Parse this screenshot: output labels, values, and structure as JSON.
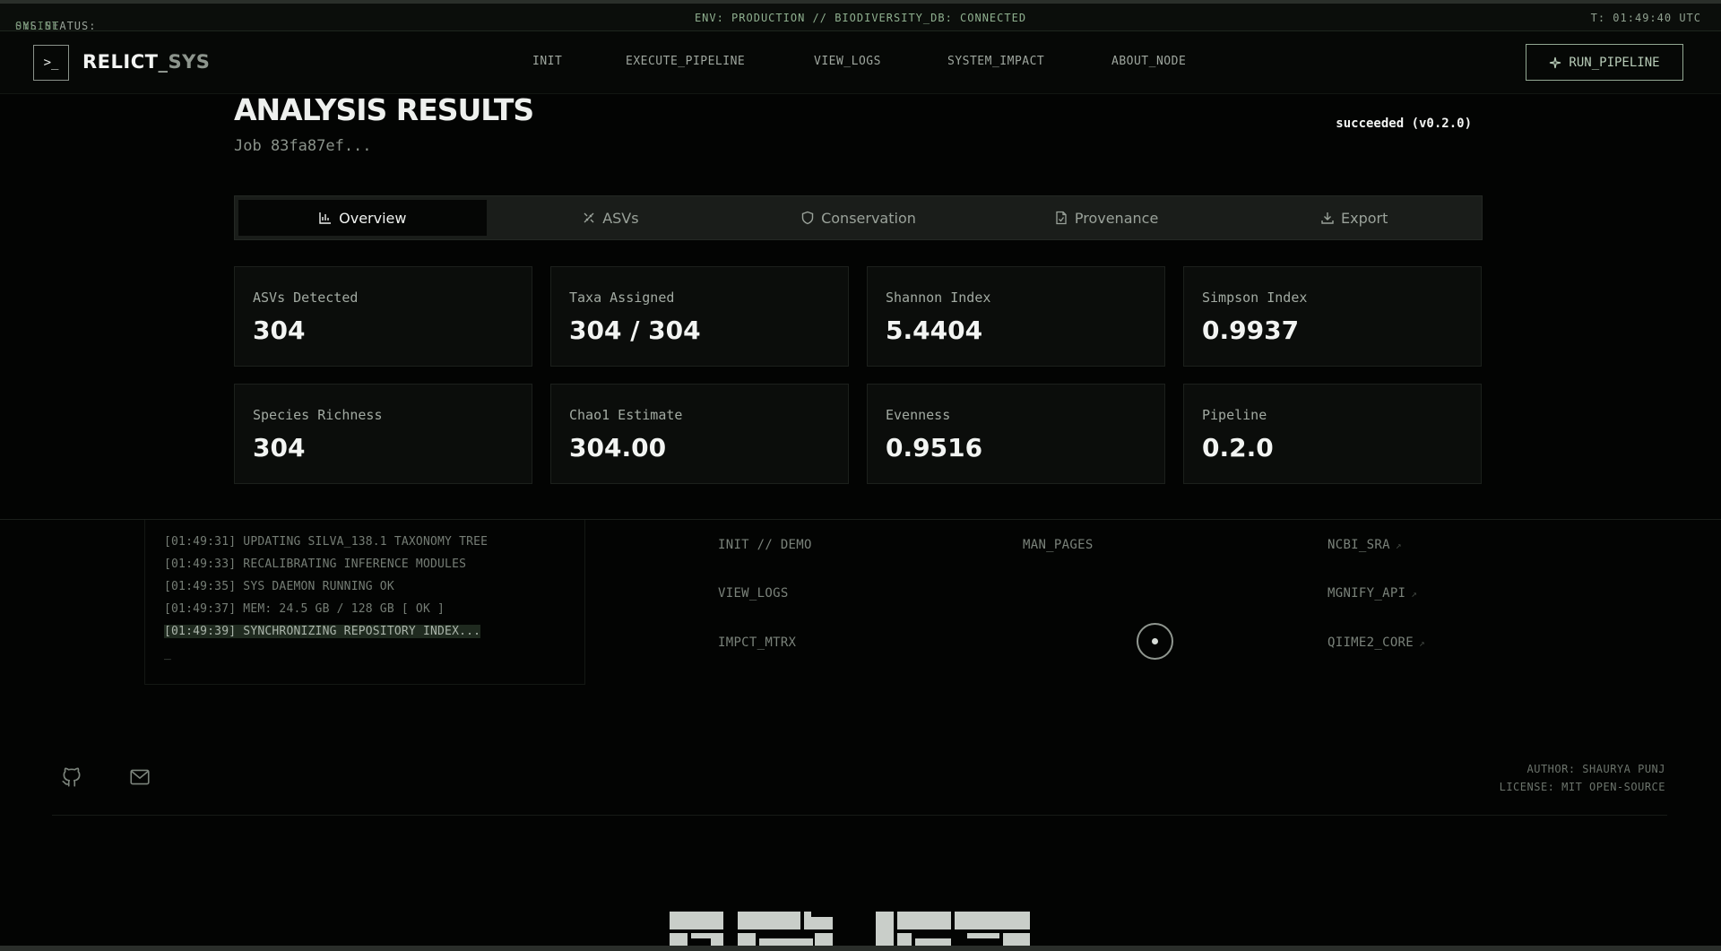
{
  "status_bar": {
    "left_label": "SYS.STATUS:",
    "left_value": "ONLINE",
    "center": "ENV: PRODUCTION // BIODIVERSITY_DB: CONNECTED",
    "right": "T: 01:49:40 UTC"
  },
  "nav": {
    "logo_glyph": ">_",
    "brand_main": "RELICT",
    "brand_dim": "_SYS",
    "links": [
      "INIT",
      "EXECUTE_PIPELINE",
      "VIEW_LOGS",
      "SYSTEM_IMPACT",
      "ABOUT_NODE"
    ],
    "run_button": "RUN_PIPELINE"
  },
  "results": {
    "title": "ANALYSIS RESULTS",
    "job": "Job 83fa87ef...",
    "status": "succeeded (v0.2.0)",
    "tabs": [
      {
        "label": "Overview",
        "icon": "bar-chart-icon"
      },
      {
        "label": "ASVs",
        "icon": "dna-icon"
      },
      {
        "label": "Conservation",
        "icon": "shield-icon"
      },
      {
        "label": "Provenance",
        "icon": "file-check-icon"
      },
      {
        "label": "Export",
        "icon": "download-icon"
      }
    ],
    "active_tab": "Overview",
    "metrics": [
      {
        "label": "ASVs Detected",
        "value": "304"
      },
      {
        "label": "Taxa Assigned",
        "value": "304 / 304"
      },
      {
        "label": "Shannon Index",
        "value": "5.4404"
      },
      {
        "label": "Simpson Index",
        "value": "0.9937"
      },
      {
        "label": "Species Richness",
        "value": "304"
      },
      {
        "label": "Chao1 Estimate",
        "value": "304.00"
      },
      {
        "label": "Evenness",
        "value": "0.9516"
      },
      {
        "label": "Pipeline",
        "value": "0.2.0"
      }
    ]
  },
  "console": {
    "lines": [
      "[01:49:31] UPDATING SILVA_138.1 TAXONOMY TREE",
      "[01:49:33] RECALIBRATING INFERENCE MODULES",
      "[01:49:35] SYS DAEMON RUNNING OK",
      "[01:49:37] MEM: 24.5 GB / 128 GB [ OK ]",
      "[01:49:39] SYNCHRONIZING REPOSITORY INDEX..."
    ],
    "cursor": "_"
  },
  "footer": {
    "col1": [
      "INIT // DEMO",
      "VIEW_LOGS",
      "IMPCT_MTRX"
    ],
    "col2": [
      "MAN_PAGES"
    ],
    "col3": [
      "NCBI_SRA",
      "MGNIFY_API",
      "QIIME2_CORE"
    ],
    "author": "AUTHOR: SHAURYA PUNJ",
    "license": "LICENSE: MIT OPEN-SOURCE",
    "social_icons": [
      "github-icon",
      "mail-icon"
    ]
  },
  "colors": {
    "background": "#030403",
    "accent": "#93a893",
    "card": "#0b0d0b"
  }
}
